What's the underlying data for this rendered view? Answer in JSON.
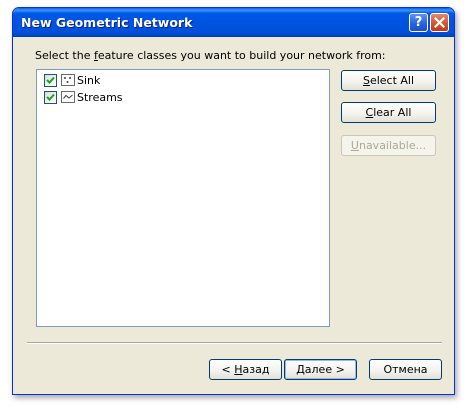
{
  "window": {
    "title": "New Geometric Network",
    "help_icon": "question-mark-icon",
    "close_icon": "close-icon"
  },
  "prompt": {
    "before": "Select the ",
    "accel": "f",
    "after": "eature classes you want to build your network from:"
  },
  "feature_classes": [
    {
      "label": "Sink",
      "checked": true,
      "icon": "point-feature-class-icon"
    },
    {
      "label": "Streams",
      "checked": true,
      "icon": "line-feature-class-icon"
    }
  ],
  "side_buttons": {
    "select_all": {
      "accel": "S",
      "rest": "elect All"
    },
    "clear_all": {
      "accel": "C",
      "rest": "lear All"
    },
    "unavailable": {
      "accel": "U",
      "rest": "navailable..."
    }
  },
  "footer_buttons": {
    "back": {
      "prefix": "< ",
      "accel": "Н",
      "rest": "азад"
    },
    "next": {
      "accel": "Д",
      "rest": "алее >"
    },
    "cancel": {
      "label": "Отмена"
    }
  },
  "colors": {
    "titlebar": "#0054e3",
    "dialog_face": "#ece9d8",
    "checkmark": "#21a121",
    "close_button": "#d8542e"
  }
}
